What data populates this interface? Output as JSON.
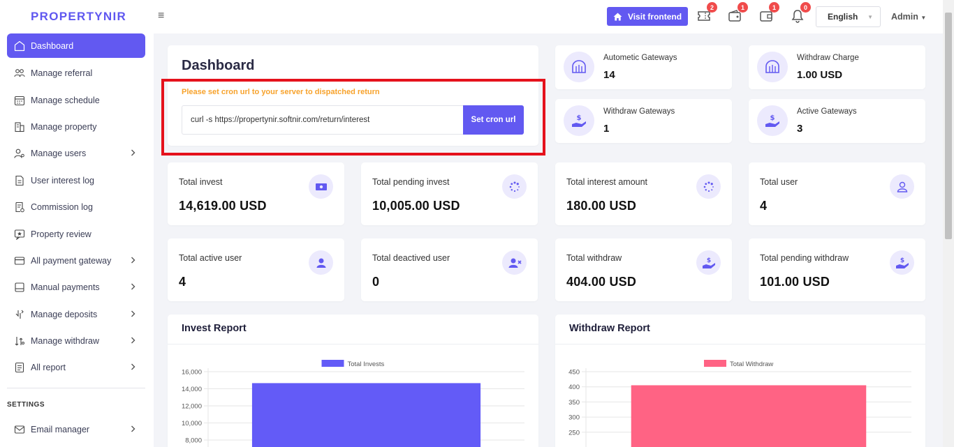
{
  "brand": "PROPERTYNIR",
  "sidebar": {
    "items": [
      {
        "label": "Dashboard",
        "icon": "home-icon",
        "active": true,
        "chevron": false
      },
      {
        "label": "Manage referral",
        "icon": "users-icon",
        "chevron": false
      },
      {
        "label": "Manage schedule",
        "icon": "calendar-icon",
        "chevron": false
      },
      {
        "label": "Manage property",
        "icon": "building-icon",
        "chevron": false
      },
      {
        "label": "Manage users",
        "icon": "user-gear-icon",
        "chevron": true
      },
      {
        "label": "User interest log",
        "icon": "file-icon",
        "chevron": false
      },
      {
        "label": "Commission log",
        "icon": "receipt-icon",
        "chevron": false
      },
      {
        "label": "Property review",
        "icon": "review-icon",
        "chevron": false
      },
      {
        "label": "All payment gateway",
        "icon": "card-icon",
        "chevron": true
      },
      {
        "label": "Manual payments",
        "icon": "wallet-icon",
        "chevron": true
      },
      {
        "label": "Manage deposits",
        "icon": "deposit-icon",
        "chevron": true
      },
      {
        "label": "Manage withdraw",
        "icon": "withdraw-icon",
        "chevron": true
      },
      {
        "label": "All report",
        "icon": "report-icon",
        "chevron": true
      }
    ],
    "settings_label": "SETTINGS",
    "settings_items": [
      {
        "label": "Email manager",
        "icon": "email-icon",
        "chevron": true
      }
    ]
  },
  "topbar": {
    "menu_icon": "≡",
    "visit_label": "Visit frontend",
    "badges": [
      "2",
      "1",
      "1",
      "0"
    ],
    "language": "English",
    "admin": "Admin"
  },
  "dashboard": {
    "title": "Dashboard",
    "cron_note": "Please set cron url to your server to dispatched return",
    "cron_url": "curl -s https://propertynir.softnir.com/return/interest",
    "cron_button": "Set cron url"
  },
  "gateways": [
    {
      "label": "Autometic Gateways",
      "value": "14",
      "icon": "bank-icon"
    },
    {
      "label": "Withdraw Charge",
      "value": "1.00 USD",
      "icon": "bank-icon"
    },
    {
      "label": "Withdraw Gateways",
      "value": "1",
      "icon": "hand-dollar-icon"
    },
    {
      "label": "Active Gateways",
      "value": "3",
      "icon": "hand-dollar-icon"
    }
  ],
  "stats": [
    {
      "label": "Total invest",
      "value": "14,619.00 USD",
      "icon": "money-icon"
    },
    {
      "label": "Total pending invest",
      "value": "10,005.00 USD",
      "icon": "spinner-icon"
    },
    {
      "label": "Total interest amount",
      "value": "180.00 USD",
      "icon": "spinner-icon"
    },
    {
      "label": "Total user",
      "value": "4",
      "icon": "user-icon"
    },
    {
      "label": "Total active user",
      "value": "4",
      "icon": "user-filled-icon"
    },
    {
      "label": "Total deactived user",
      "value": "0",
      "icon": "user-x-icon"
    },
    {
      "label": "Total withdraw",
      "value": "404.00 USD",
      "icon": "hand-dollar-icon"
    },
    {
      "label": "Total pending withdraw",
      "value": "101.00 USD",
      "icon": "hand-dollar-icon"
    }
  ],
  "reports": [
    {
      "title": "Invest Report"
    },
    {
      "title": "Withdraw Report"
    }
  ],
  "colors": {
    "accent": "#6259f1",
    "invest_bar": "#635bf7",
    "withdraw_bar": "#ff6384",
    "warning": "#f7a22b",
    "highlight": "#e5121c"
  },
  "chart_data": [
    {
      "type": "bar",
      "title": "",
      "legend": "top",
      "series": [
        {
          "name": "Total Invests",
          "values": [
            14619
          ]
        }
      ],
      "yticks": [
        "16,000",
        "14,000",
        "12,000",
        "10,000",
        "8,000"
      ],
      "ylim": [
        8000,
        16000
      ],
      "grid": true
    },
    {
      "type": "bar",
      "title": "",
      "legend": "top",
      "series": [
        {
          "name": "Total Withdraw",
          "values": [
            404
          ]
        }
      ],
      "yticks": [
        "450",
        "400",
        "350",
        "300",
        "250"
      ],
      "ylim": [
        250,
        450
      ],
      "grid": true
    }
  ]
}
